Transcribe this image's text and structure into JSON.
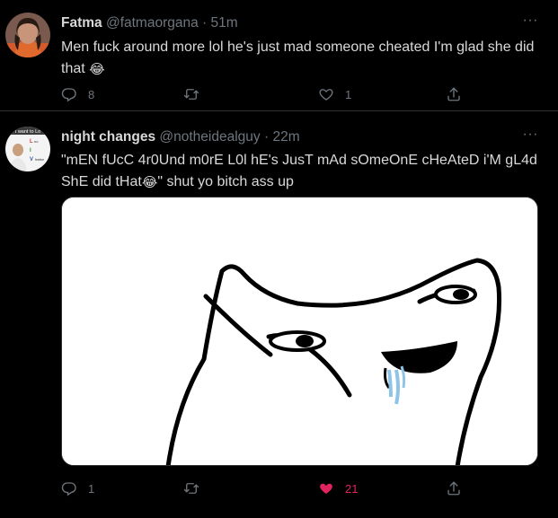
{
  "tweets": [
    {
      "name": "Fatma",
      "handle": "@fatmaorgana",
      "time": "51m",
      "dot": "·",
      "more": "···",
      "text": "Men fuck around more lol he's just mad someone cheated I'm glad she did that",
      "emoji": "😂",
      "reply_count": "8",
      "retweet_count": "",
      "like_count": "1",
      "liked": false
    },
    {
      "name": "night changes",
      "handle": "@notheidealguy",
      "time": "22m",
      "dot": "·",
      "more": "···",
      "text_before": "\"mEN fUcC 4r0Und m0rE L0l hE's JusT mAd sOmeOnE cHeAteD i'M gL4d ShE did tHat",
      "emoji": "😂",
      "text_after": "\" shut yo bitch ass up",
      "avatar_text": "I want to Lo",
      "reply_count": "1",
      "retweet_count": "",
      "like_count": "21",
      "liked": true
    }
  ],
  "colors": {
    "background": "#000000",
    "text": "#d9d9d9",
    "secondary": "#6e767d",
    "divider": "#2f3336",
    "like_active": "#e0245e"
  },
  "icons": [
    "reply-icon",
    "retweet-icon",
    "like-icon",
    "share-icon",
    "more-icon"
  ]
}
